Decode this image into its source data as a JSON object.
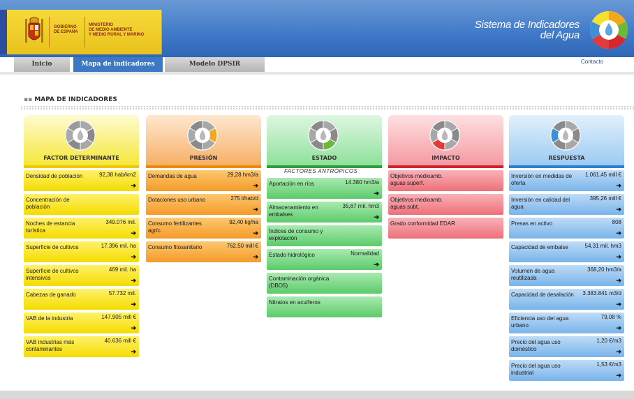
{
  "header": {
    "gov_line1": "GOBIERNO",
    "gov_line2": "DE ESPAÑA",
    "min_line1": "MINISTERIO",
    "min_line2": "DE MEDIO AMBIENTE",
    "min_line3": "Y MEDIO RURAL Y MARINO",
    "site_line1": "Sistema de Indicadores",
    "site_line2": "del Agua"
  },
  "tabs": [
    {
      "label": "Inicio"
    },
    {
      "label": "Mapa de indicadores"
    },
    {
      "label": "Modelo DPSIR"
    }
  ],
  "contact_label": "Contacto",
  "section_title": "MAPA DE INDICADORES",
  "factores_label": "FACTORES ANTRÓPICOS",
  "arrow_glyph": "➔",
  "columns": [
    {
      "title": "FACTOR DETERMINANTE",
      "color": "#f6e93a",
      "indicators": [
        {
          "name": "Densidad de población",
          "value": "92,38 hab/km2"
        },
        {
          "name": "Concentración de población",
          "value": ""
        },
        {
          "name": "Noches de estancia turística",
          "value": "349.076 mil."
        },
        {
          "name": "Superficie de cultivos",
          "value": "17.396 mil. ha"
        },
        {
          "name": "Superficie de cultivos intensivos",
          "value": "469 mil. ha"
        },
        {
          "name": "Cabezas de ganado",
          "value": "57.732 mil."
        },
        {
          "name": "VAB de la industria",
          "value": "147.905 mill €"
        },
        {
          "name": "VAB industrias más contaminantes",
          "value": "40.636 mill €"
        }
      ]
    },
    {
      "title": "PRESIÓN",
      "color": "#f5a83a",
      "indicators": [
        {
          "name": "Demandas de agua",
          "value": "29,28 hm3/a"
        },
        {
          "name": "Dotaciones uso urbano",
          "value": "275 l/hab/d"
        },
        {
          "name": "Consumo fertilizantes agríc.",
          "value": "92,40 kg/ha"
        },
        {
          "name": "Consumo fitosanitario",
          "value": "762,50 mill €"
        }
      ]
    },
    {
      "title": "ESTADO",
      "color": "#7fd98a",
      "indicators": [
        {
          "name": "Aportación en ríos",
          "value": "14.380 hm3/a"
        },
        {
          "name": "Almacenamiento en embalses",
          "value": "35,67 mil. hm3"
        },
        {
          "name": "Índices de consumo y explotación",
          "value": ""
        },
        {
          "name": "Estado hidrológico",
          "value": "Normalidad"
        },
        {
          "name": "Contaminación orgánica (DBO5)",
          "value": ""
        },
        {
          "name": "Nitratos en acuíferos",
          "value": ""
        }
      ]
    },
    {
      "title": "IMPACTO",
      "color": "#f28a92",
      "indicators": [
        {
          "name": "Objetivos medioamb. aguas superf.",
          "value": ""
        },
        {
          "name": "Objetivos medioamb. aguas subt.",
          "value": ""
        },
        {
          "name": "Grado conformidad EDAR",
          "value": ""
        }
      ]
    },
    {
      "title": "RESPUESTA",
      "color": "#8ec3ef",
      "indicators": [
        {
          "name": "Inversión en medidas de oferta",
          "value": "1.061,45 mill €"
        },
        {
          "name": "Inversión en calidad del agua",
          "value": "395,26 mill €"
        },
        {
          "name": "Presas en activo",
          "value": "808"
        },
        {
          "name": "Capacidad de embalse",
          "value": "54,31 mil. hm3"
        },
        {
          "name": "Volumen de agua reutilizada",
          "value": "368,20 hm3/a"
        },
        {
          "name": "Capacidad de desalación",
          "value": "3.383.841 m3/d"
        },
        {
          "name": "Eficiencia uso del agua urbano",
          "value": "79,08 %"
        },
        {
          "name": "Precio del agua uso doméstico",
          "value": "1,20 €/m3"
        },
        {
          "name": "Precio del agua uso industrial",
          "value": "1,53 €/m3"
        }
      ]
    }
  ]
}
